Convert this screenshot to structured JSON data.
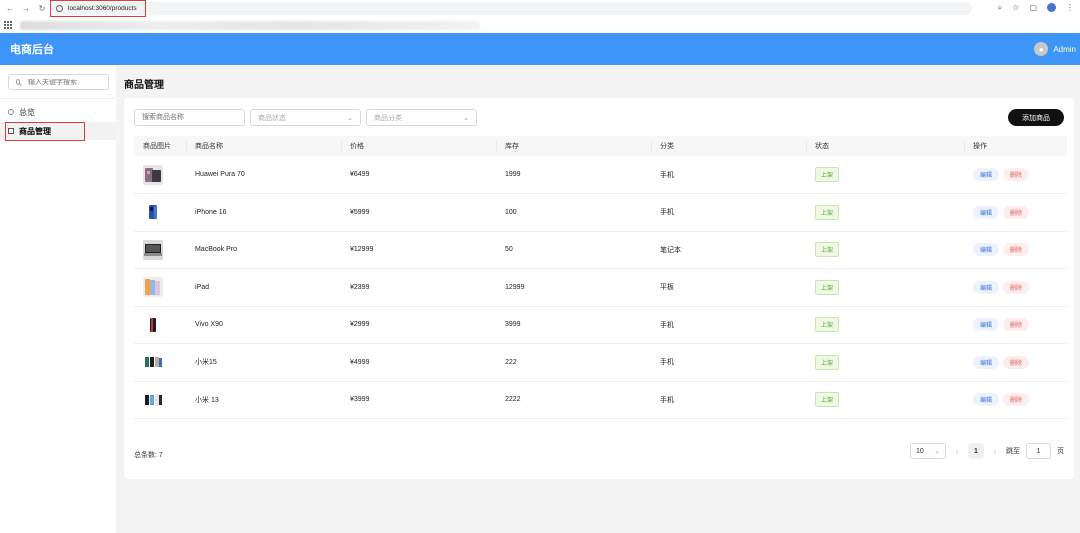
{
  "browser": {
    "url": "localhost:3060/products",
    "icons": [
      "back-icon",
      "forward-icon",
      "reload-icon",
      "info-icon",
      "zoom-icon",
      "star-icon",
      "extensions-icon",
      "profile-icon",
      "more-icon",
      "apps-icon"
    ]
  },
  "header": {
    "title": "电商后台",
    "user_name": "Admin",
    "brand_color": "#3d96f7"
  },
  "sidebar": {
    "search_placeholder": "输入关键字搜索",
    "items": [
      {
        "label": "总览",
        "icon": "overview-icon",
        "active": false
      },
      {
        "label": "商品管理",
        "icon": "product-icon",
        "active": true
      }
    ]
  },
  "page": {
    "title": "商品管理",
    "filters": {
      "name_placeholder": "搜索商品名称",
      "status_placeholder": "商品状态",
      "category_placeholder": "商品分类"
    },
    "add_button": "添加商品"
  },
  "table": {
    "columns": [
      "商品图片",
      "商品名称",
      "价格",
      "库存",
      "分类",
      "状态",
      "操作"
    ],
    "rows": [
      {
        "name": "Huawei Pura 70",
        "price": "¥6499",
        "stock": "1999",
        "category": "手机",
        "status": "上架",
        "edit": "编辑",
        "delete": "删除",
        "image": "phone-photo"
      },
      {
        "name": "iPhone 16",
        "price": "¥5999",
        "stock": "100",
        "category": "手机",
        "status": "上架",
        "edit": "编辑",
        "delete": "删除",
        "image": "phone-photo"
      },
      {
        "name": "MacBook Pro",
        "price": "¥12999",
        "stock": "50",
        "category": "笔记本",
        "status": "上架",
        "edit": "编辑",
        "delete": "删除",
        "image": "laptop-photo"
      },
      {
        "name": "iPad",
        "price": "¥2399",
        "stock": "12999",
        "category": "平板",
        "status": "上架",
        "edit": "编辑",
        "delete": "删除",
        "image": "tablet-photo"
      },
      {
        "name": "Vivo X90",
        "price": "¥2999",
        "stock": "3999",
        "category": "手机",
        "status": "上架",
        "edit": "编辑",
        "delete": "删除",
        "image": "phone-photo"
      },
      {
        "name": "小米15",
        "price": "¥4999",
        "stock": "222",
        "category": "手机",
        "status": "上架",
        "edit": "编辑",
        "delete": "删除",
        "image": "phone-photo"
      },
      {
        "name": "小米 13",
        "price": "¥3999",
        "stock": "2222",
        "category": "手机",
        "status": "上架",
        "edit": "编辑",
        "delete": "删除",
        "image": "phone-photo"
      }
    ]
  },
  "footer": {
    "total_label": "总条数:",
    "total_count": "7",
    "page_size": "10",
    "current_page": "1",
    "jump_label": "跳至",
    "jump_value": "1",
    "page_unit": "页"
  }
}
